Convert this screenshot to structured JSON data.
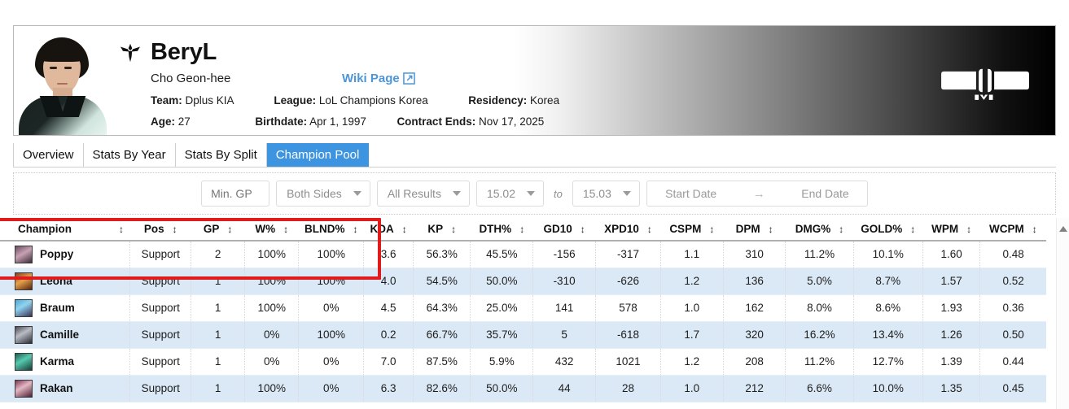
{
  "player": {
    "name": "BeryL",
    "real_name": "Cho Geon-hee",
    "wiki_link": "Wiki Page",
    "wiki_icon": "external-link-icon",
    "team_label": "Team:",
    "team_value": "Dplus KIA",
    "league_label": "League:",
    "league_value": "LoL Champions Korea",
    "residency_label": "Residency:",
    "residency_value": "Korea",
    "age_label": "Age:",
    "age_value": "27",
    "birthdate_label": "Birthdate:",
    "birthdate_value": "Apr 1, 1997",
    "contract_label": "Contract Ends:",
    "contract_value": "Nov 17, 2025",
    "team_logo": "dplus-kia-logo",
    "portrait": "player-portrait"
  },
  "tabs": [
    {
      "label": "Overview",
      "active": false
    },
    {
      "label": "Stats By Year",
      "active": false
    },
    {
      "label": "Stats By Split",
      "active": false
    },
    {
      "label": "Champion Pool",
      "active": true
    }
  ],
  "filters": {
    "min_gp_placeholder": "Min. GP",
    "min_gp_value": "",
    "sides": "Both Sides",
    "results": "All Results",
    "patch_from": "15.02",
    "to_label": "to",
    "patch_to": "15.03",
    "start_date": "Start Date",
    "range_arrow": "→",
    "end_date": "End Date"
  },
  "table": {
    "sort_icon": "↕",
    "columns": [
      "Champion",
      "Pos",
      "GP",
      "W%",
      "BLND%",
      "KDA",
      "KP",
      "DTH%",
      "GD10",
      "XPD10",
      "CSPM",
      "DPM",
      "DMG%",
      "GOLD%",
      "WPM",
      "WCPM"
    ],
    "rows": [
      {
        "champion": "Poppy",
        "icon": "champion-icon-poppy",
        "pos": "Support",
        "gp": "2",
        "wp": "100%",
        "blnd": "100%",
        "kda": "3.6",
        "kp": "56.3%",
        "dth": "45.5%",
        "gd10": "-156",
        "xpd10": "-317",
        "cspm": "1.1",
        "dpm": "310",
        "dmg": "11.2%",
        "gold": "10.1%",
        "wpm": "1.60",
        "wcpm": "0.48"
      },
      {
        "champion": "Leona",
        "icon": "champion-icon-leona",
        "pos": "Support",
        "gp": "1",
        "wp": "100%",
        "blnd": "100%",
        "kda": "4.0",
        "kp": "54.5%",
        "dth": "50.0%",
        "gd10": "-310",
        "xpd10": "-626",
        "cspm": "1.2",
        "dpm": "136",
        "dmg": "5.0%",
        "gold": "8.7%",
        "wpm": "1.57",
        "wcpm": "0.52"
      },
      {
        "champion": "Braum",
        "icon": "champion-icon-braum",
        "pos": "Support",
        "gp": "1",
        "wp": "100%",
        "blnd": "0%",
        "kda": "4.5",
        "kp": "64.3%",
        "dth": "25.0%",
        "gd10": "141",
        "xpd10": "578",
        "cspm": "1.0",
        "dpm": "162",
        "dmg": "8.0%",
        "gold": "8.6%",
        "wpm": "1.93",
        "wcpm": "0.36"
      },
      {
        "champion": "Camille",
        "icon": "champion-icon-camille",
        "pos": "Support",
        "gp": "1",
        "wp": "0%",
        "blnd": "100%",
        "kda": "0.2",
        "kp": "66.7%",
        "dth": "35.7%",
        "gd10": "5",
        "xpd10": "-618",
        "cspm": "1.7",
        "dpm": "320",
        "dmg": "16.2%",
        "gold": "13.4%",
        "wpm": "1.26",
        "wcpm": "0.50"
      },
      {
        "champion": "Karma",
        "icon": "champion-icon-karma",
        "pos": "Support",
        "gp": "1",
        "wp": "0%",
        "blnd": "0%",
        "kda": "7.0",
        "kp": "87.5%",
        "dth": "5.9%",
        "gd10": "432",
        "xpd10": "1021",
        "cspm": "1.2",
        "dpm": "208",
        "dmg": "11.2%",
        "gold": "12.7%",
        "wpm": "1.39",
        "wcpm": "0.44"
      },
      {
        "champion": "Rakan",
        "icon": "champion-icon-rakan",
        "pos": "Support",
        "gp": "1",
        "wp": "100%",
        "blnd": "0%",
        "kda": "6.3",
        "kp": "82.6%",
        "dth": "50.0%",
        "gd10": "44",
        "xpd10": "28",
        "cspm": "1.0",
        "dpm": "212",
        "dmg": "6.6%",
        "gold": "10.0%",
        "wpm": "1.35",
        "wcpm": "0.45"
      }
    ]
  },
  "scrollbar": {
    "up_arrow": "scroll-up-arrow"
  },
  "annotation": {
    "type": "red-highlight-rectangle",
    "color": "#e01b1b"
  },
  "colors": {
    "accent_blue": "#3d94e0",
    "link_blue": "#4c95d9",
    "row_alt": "#dbe9f6",
    "annotation_red": "#e01b1b"
  }
}
